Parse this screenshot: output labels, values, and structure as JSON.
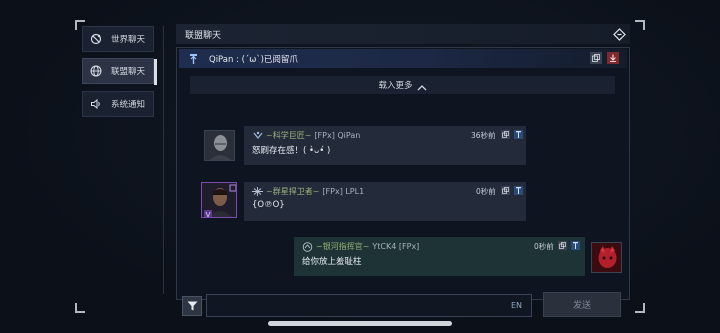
{
  "nav": {
    "items": [
      {
        "label": "世界聊天",
        "icon": "world-chat-icon"
      },
      {
        "label": "联盟聊天",
        "icon": "globe-icon",
        "active": true
      },
      {
        "label": "系统通知",
        "icon": "speaker-icon"
      }
    ]
  },
  "panel": {
    "title": "联盟聊天",
    "pinned": {
      "text": "QiPan : (´ω`)已阅留爪"
    },
    "load_more": "载入更多"
  },
  "messages": [
    {
      "rank": "~科学巨匠~",
      "tag": "[FPx] QiPan",
      "time": "36秒前",
      "body": "怒刷存在感！( •̀ᴗ•́ )",
      "side": "left"
    },
    {
      "rank": "~群星捍卫者~",
      "tag": "[FPx] LPL1",
      "time": "0秒前",
      "body": "{O℗O}",
      "side": "left"
    },
    {
      "rank": "~银河指挥官~",
      "tag": "YtCK4 [FPx]",
      "time": "0秒前",
      "body": "给你放上羞耻柱",
      "side": "right"
    }
  ],
  "input": {
    "value": "",
    "placeholder": "",
    "lang": "EN",
    "send_label": "发送"
  },
  "colors": {
    "accent_green": "#9ab27a",
    "bubble_other": "#232b3b",
    "bubble_mine": "#1d3335",
    "pin_bar": "#1f2d4e"
  }
}
